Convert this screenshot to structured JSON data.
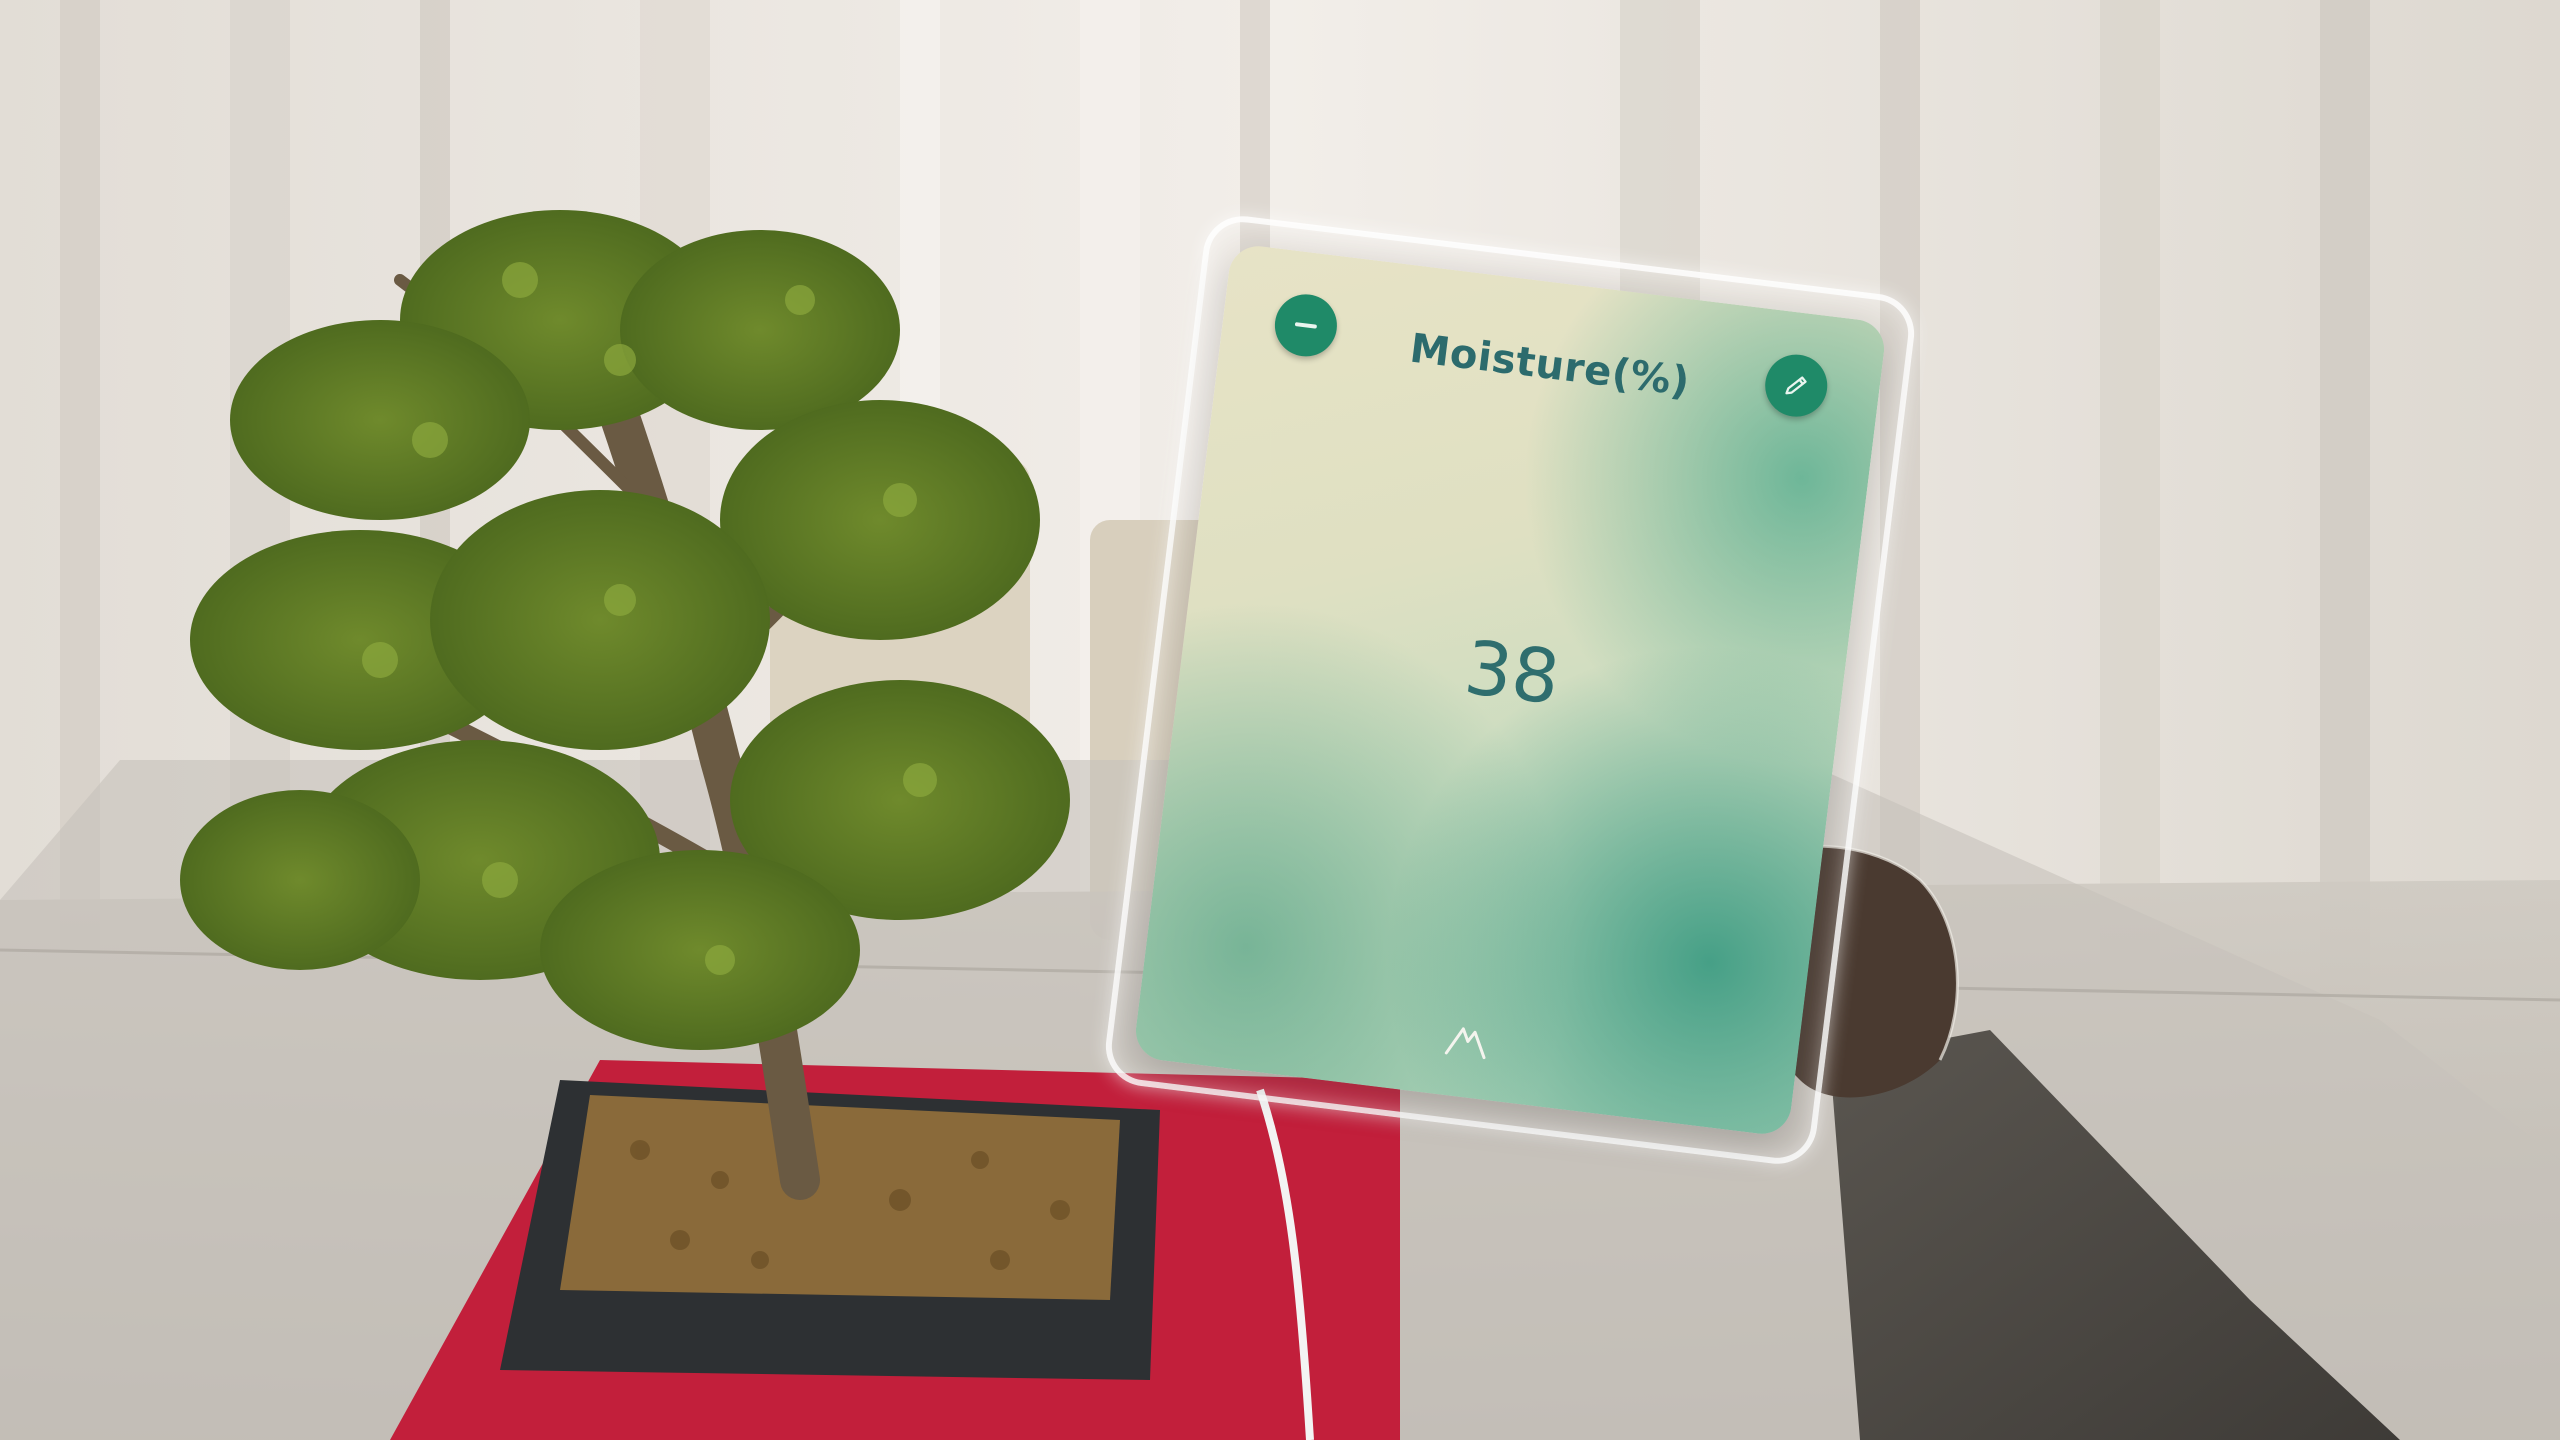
{
  "panel": {
    "title": "Moisture(%)",
    "value": "38",
    "minimize_icon": "minus-icon",
    "edit_icon": "pencil-icon",
    "brand_icon": "brand-logo-icon"
  },
  "colors": {
    "accent": "#1f8a68",
    "title_text": "#2c6b6d",
    "panel_gradient_light": "#e7e3c6",
    "panel_gradient_green": "#32967d"
  }
}
